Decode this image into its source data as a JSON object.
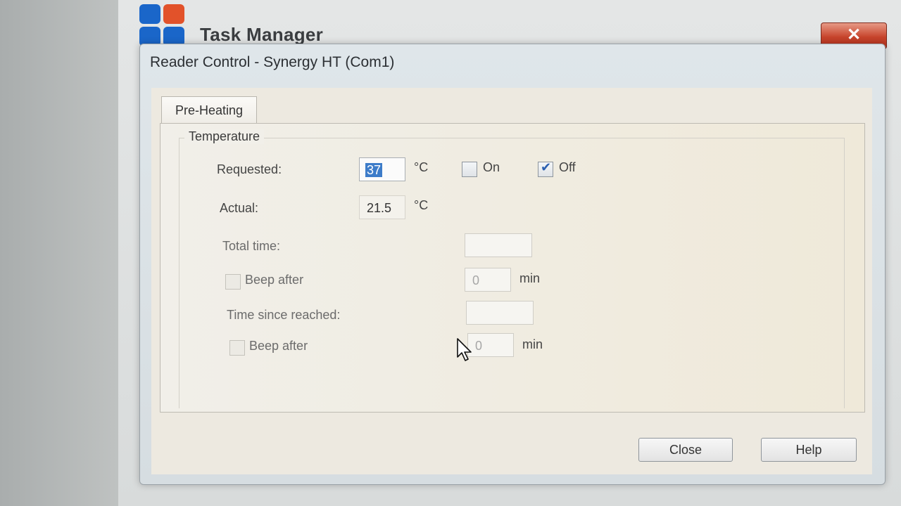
{
  "background_window": {
    "title": "Task Manager",
    "close_glyph": "✕",
    "logo_colors": [
      "#1a66c9",
      "#e2522a",
      "#1a66c9",
      "#1a66c9"
    ]
  },
  "dialog": {
    "title": "Reader Control - Synergy HT (Com1)",
    "tab_label": "Pre-Heating",
    "group_title": "Temperature",
    "requested": {
      "label": "Requested:",
      "value": "37",
      "unit": "°C",
      "on_label": "On",
      "on_checked": false,
      "off_label": "Off",
      "off_checked": true
    },
    "actual": {
      "label": "Actual:",
      "value": "21.5",
      "unit": "°C"
    },
    "total_time": {
      "label": "Total time:",
      "value": "",
      "beep_label": "Beep after",
      "beep_checked": false,
      "beep_value": "0",
      "beep_unit": "min"
    },
    "time_since_reached": {
      "label": "Time since reached:",
      "value": "",
      "beep_label": "Beep after",
      "beep_checked": false,
      "beep_value": "0",
      "beep_unit": "min"
    },
    "buttons": {
      "close": "Close",
      "help": "Help"
    }
  }
}
